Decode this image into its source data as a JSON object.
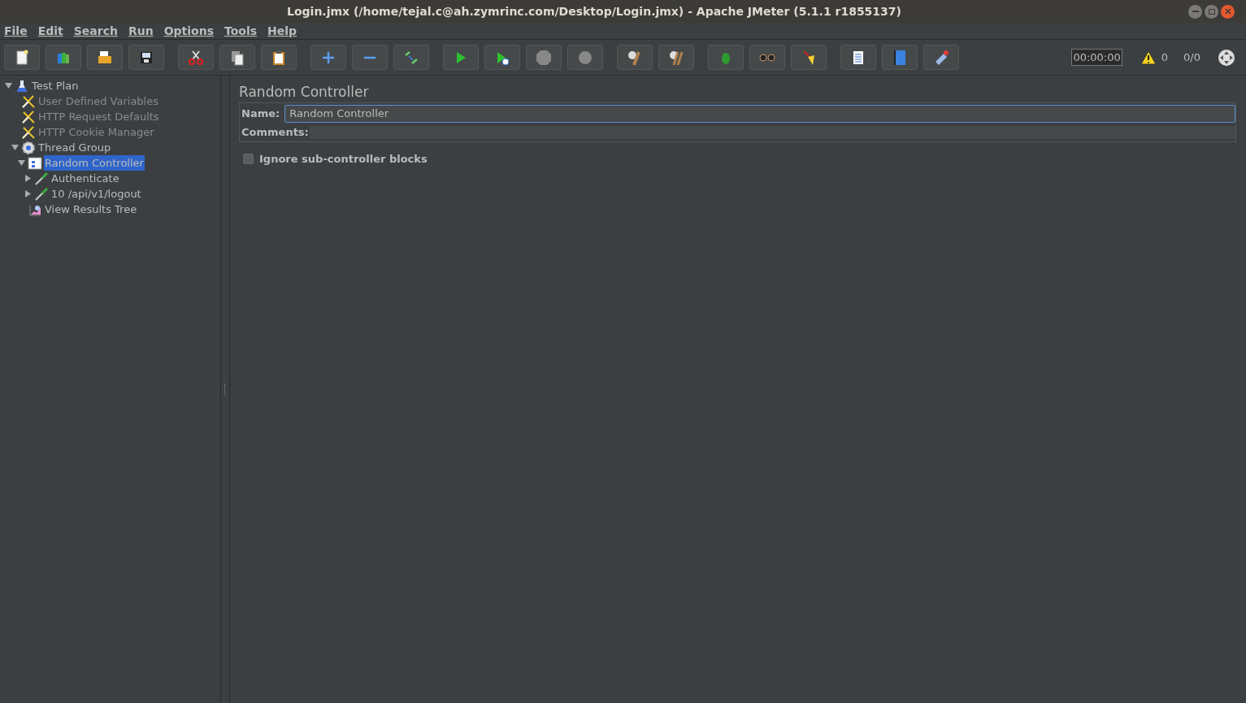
{
  "window": {
    "title": "Login.jmx (/home/tejal.c@ah.zymrinc.com/Desktop/Login.jmx) - Apache JMeter (5.1.1 r1855137)"
  },
  "menu": [
    "File",
    "Edit",
    "Search",
    "Run",
    "Options",
    "Tools",
    "Help"
  ],
  "status": {
    "timer": "00:00:00",
    "warnings": "0",
    "threads": "0/0"
  },
  "tree": [
    {
      "label": "Test Plan",
      "kind": "plan",
      "expanded": true,
      "disabled": false,
      "selected": false,
      "children": [
        {
          "label": "User Defined Variables",
          "kind": "config",
          "disabled": true,
          "selected": false
        },
        {
          "label": "HTTP Request Defaults",
          "kind": "config",
          "disabled": true,
          "selected": false
        },
        {
          "label": "HTTP Cookie Manager",
          "kind": "config",
          "disabled": true,
          "selected": false
        },
        {
          "label": "Thread Group",
          "kind": "threads",
          "expanded": true,
          "disabled": false,
          "selected": false,
          "children": [
            {
              "label": "Random Controller",
              "kind": "controller",
              "expanded": true,
              "disabled": false,
              "selected": true,
              "children": [
                {
                  "label": "Authenticate",
                  "kind": "sampler",
                  "expanded": false,
                  "disabled": false,
                  "selected": false
                },
                {
                  "label": "10 /api/v1/logout",
                  "kind": "sampler",
                  "expanded": false,
                  "disabled": false,
                  "selected": false
                }
              ]
            },
            {
              "label": "View Results Tree",
              "kind": "listener",
              "disabled": false,
              "selected": false
            }
          ]
        }
      ]
    }
  ],
  "panel": {
    "heading": "Random Controller",
    "name_label": "Name:",
    "name_value": "Random Controller",
    "comments_label": "Comments:",
    "option": {
      "label": "Ignore sub-controller blocks",
      "checked": false
    }
  }
}
